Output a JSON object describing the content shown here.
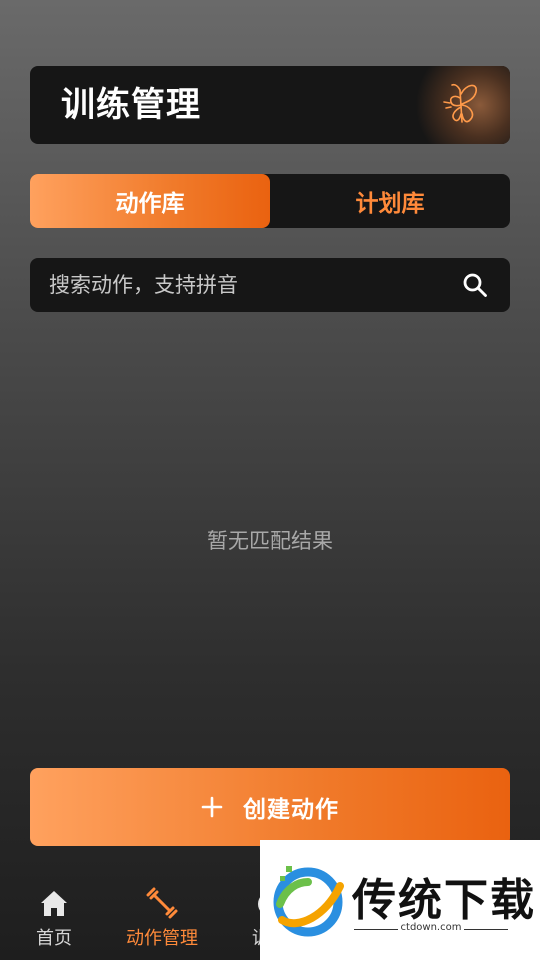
{
  "header": {
    "title": "训练管理",
    "logo_icon": "butterfly-icon"
  },
  "tabs": [
    {
      "label": "动作库",
      "active": true
    },
    {
      "label": "计划库",
      "active": false
    }
  ],
  "search": {
    "placeholder": "搜索动作，支持拼音",
    "value": "",
    "icon": "search-icon"
  },
  "empty_state": {
    "text": "暂无匹配结果"
  },
  "create_button": {
    "label": "创建动作",
    "icon": "plus-icon"
  },
  "bottom_nav": [
    {
      "label": "首页",
      "icon": "home-icon",
      "active": false
    },
    {
      "label": "动作管理",
      "icon": "dumbbell-icon",
      "active": true
    },
    {
      "label": "训练",
      "icon": "timer-icon",
      "active": false
    }
  ],
  "watermark": {
    "title": "传统下载",
    "subtitle": "ctdown.com"
  },
  "colors": {
    "accent": "#F07A2A",
    "accent_light": "#FFA15E",
    "card_bg": "#161616"
  }
}
